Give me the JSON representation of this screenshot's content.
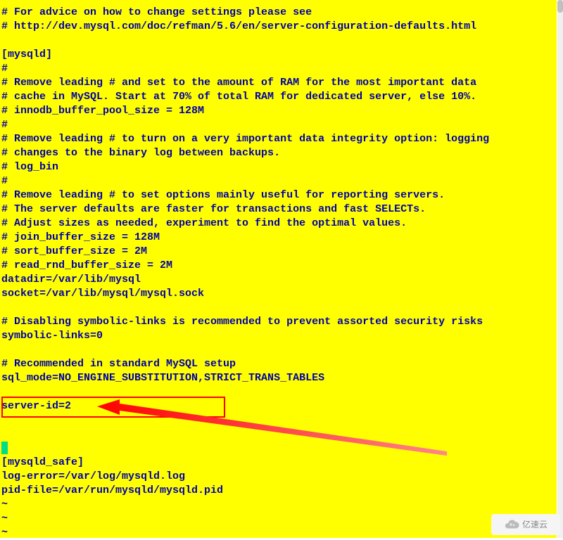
{
  "config": {
    "lines": [
      "# For advice on how to change settings please see",
      "# http://dev.mysql.com/doc/refman/5.6/en/server-configuration-defaults.html",
      "",
      "[mysqld]",
      "#",
      "# Remove leading # and set to the amount of RAM for the most important data",
      "# cache in MySQL. Start at 70% of total RAM for dedicated server, else 10%.",
      "# innodb_buffer_pool_size = 128M",
      "#",
      "# Remove leading # to turn on a very important data integrity option: logging",
      "# changes to the binary log between backups.",
      "# log_bin",
      "#",
      "# Remove leading # to set options mainly useful for reporting servers.",
      "# The server defaults are faster for transactions and fast SELECTs.",
      "# Adjust sizes as needed, experiment to find the optimal values.",
      "# join_buffer_size = 128M",
      "# sort_buffer_size = 2M",
      "# read_rnd_buffer_size = 2M",
      "datadir=/var/lib/mysql",
      "socket=/var/lib/mysql/mysql.sock",
      "",
      "# Disabling symbolic-links is recommended to prevent assorted security risks",
      "symbolic-links=0",
      "",
      "# Recommended in standard MySQL setup",
      "sql_mode=NO_ENGINE_SUBSTITUTION,STRICT_TRANS_TABLES",
      "",
      "server-id=2",
      "",
      "",
      "",
      "[mysqld_safe]",
      "log-error=/var/log/mysqld.log",
      "pid-file=/var/run/mysqld/mysqld.pid",
      "~",
      "~",
      "~"
    ],
    "highlighted_line_index": 28,
    "highlighted_value": "server-id=2",
    "cursor_line_index": 31
  },
  "annotation": {
    "color": "#ff0000"
  },
  "watermark": {
    "text": "亿速云"
  }
}
